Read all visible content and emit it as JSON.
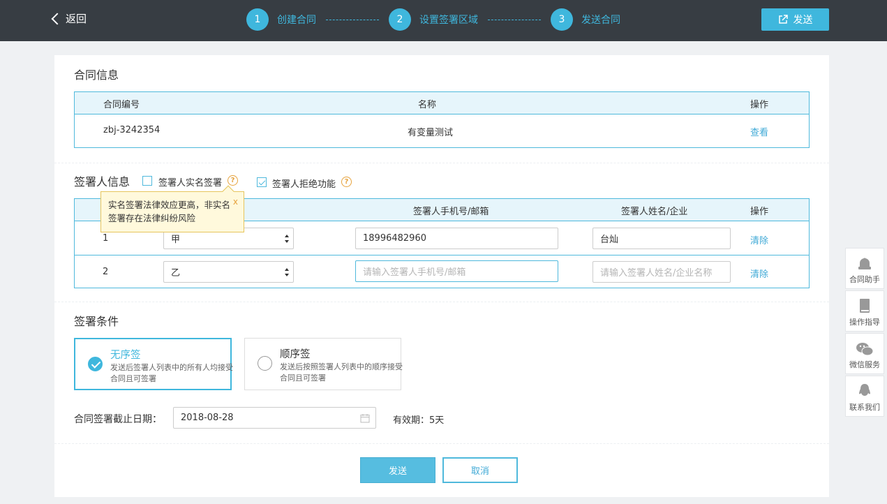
{
  "header": {
    "back_label": "返回",
    "steps": [
      {
        "num": "1",
        "label": "创建合同"
      },
      {
        "num": "2",
        "label": "设置签署区域"
      },
      {
        "num": "3",
        "label": "发送合同"
      }
    ],
    "send_label": "发送"
  },
  "contract_info": {
    "title": "合同信息",
    "columns": [
      "合同编号",
      "名称",
      "操作"
    ],
    "row": {
      "id": "zbj-3242354",
      "name": "有变量测试",
      "action": "查看"
    }
  },
  "signer_info": {
    "title": "签署人信息",
    "realname_label": "签署人实名签署",
    "realname_checked": false,
    "reject_label": "签署人拒绝功能",
    "reject_checked": true,
    "tooltip": "实名签署法律效应更高，非实名签署存在法律纠纷风险",
    "tooltip_close": "x",
    "columns": [
      "签署人手机号/邮箱",
      "签署人姓名/企业",
      "操作"
    ],
    "rows": [
      {
        "num": "1",
        "role": "甲",
        "contact": "18996482960",
        "name": "台灿",
        "action": "清除"
      },
      {
        "num": "2",
        "role": "乙",
        "contact_placeholder": "请输入签署人手机号/邮箱",
        "name_placeholder": "请输入签署人姓名/企业名称",
        "action": "清除"
      }
    ]
  },
  "conditions": {
    "title": "签署条件",
    "options": [
      {
        "title": "无序签",
        "desc": "发送后签署人列表中的所有人均接受合同且可签署",
        "selected": true
      },
      {
        "title": "顺序签",
        "desc": "发送后按照签署人列表中的顺序接受合同且可签署",
        "selected": false
      }
    ],
    "deadline_label": "合同签署截止日期：",
    "deadline_value": "2018-08-28",
    "validity": "有效期：5天"
  },
  "actions": {
    "submit": "发送",
    "cancel": "取消"
  },
  "side": [
    {
      "icon": "robot-icon",
      "label": "合同助手"
    },
    {
      "icon": "book-icon",
      "label": "操作指导"
    },
    {
      "icon": "wechat-icon",
      "label": "微信服务"
    },
    {
      "icon": "qq-icon",
      "label": "联系我们"
    }
  ],
  "colors": {
    "accent": "#3fb7dd",
    "topbar": "#373d43",
    "warn": "#e6a23c"
  }
}
